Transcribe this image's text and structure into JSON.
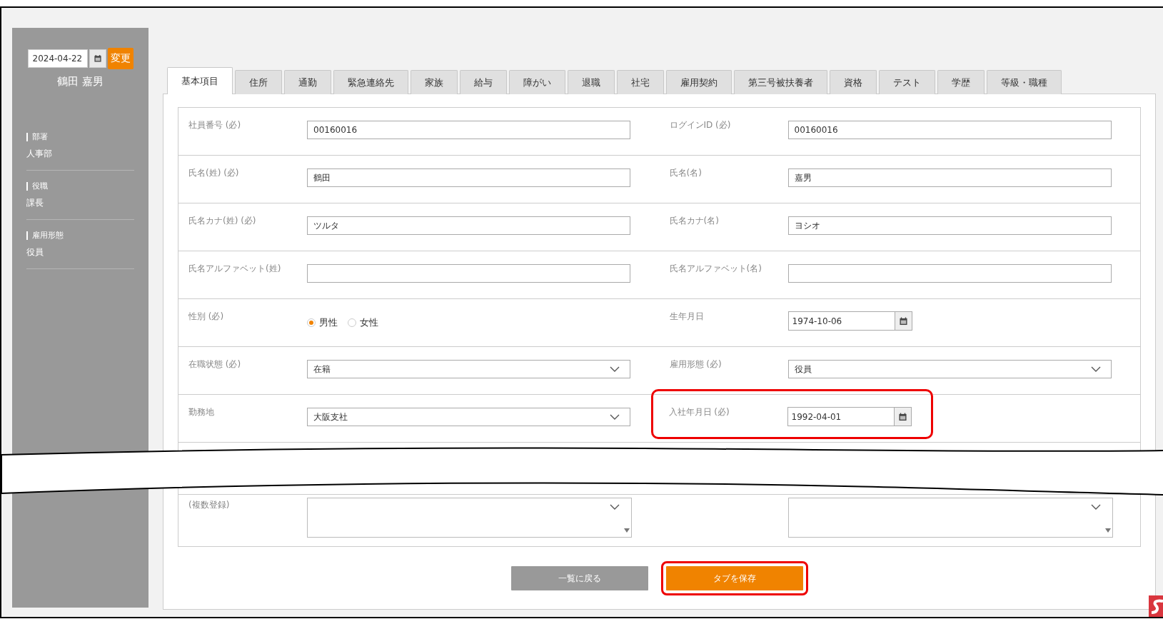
{
  "sidebar": {
    "date": "2024-04-22",
    "change_button": "変更",
    "employee_name": "鶴田 嘉男",
    "info": [
      {
        "label": "部署",
        "value": "人事部"
      },
      {
        "label": "役職",
        "value": "課長"
      },
      {
        "label": "雇用形態",
        "value": "役員"
      }
    ]
  },
  "tabs": [
    {
      "label": "基本項目",
      "selected": true
    },
    {
      "label": "住所",
      "selected": false
    },
    {
      "label": "通勤",
      "selected": false
    },
    {
      "label": "緊急連絡先",
      "selected": false
    },
    {
      "label": "家族",
      "selected": false
    },
    {
      "label": "給与",
      "selected": false
    },
    {
      "label": "障がい",
      "selected": false
    },
    {
      "label": "退職",
      "selected": false
    },
    {
      "label": "社宅",
      "selected": false
    },
    {
      "label": "雇用契約",
      "selected": false
    },
    {
      "label": "第三号被扶養者",
      "selected": false
    },
    {
      "label": "資格",
      "selected": false
    },
    {
      "label": "テスト",
      "selected": false
    },
    {
      "label": "学歴",
      "selected": false
    },
    {
      "label": "等級・職種",
      "selected": false
    }
  ],
  "form_rows": [
    [
      {
        "kind": "text",
        "label": "社員番号 (必)",
        "value": "00160016",
        "highlighted": false
      },
      {
        "kind": "text",
        "label": "ログインID (必)",
        "value": "00160016",
        "highlighted": false
      }
    ],
    [
      {
        "kind": "text",
        "label": "氏名(姓) (必)",
        "value": "鶴田",
        "highlighted": false
      },
      {
        "kind": "text",
        "label": "氏名(名)",
        "value": "嘉男",
        "highlighted": false
      }
    ],
    [
      {
        "kind": "text",
        "label": "氏名カナ(姓) (必)",
        "value": "ツルタ",
        "highlighted": false
      },
      {
        "kind": "text",
        "label": "氏名カナ(名)",
        "value": "ヨシオ",
        "highlighted": false
      }
    ],
    [
      {
        "kind": "text",
        "label": "氏名アルファベット(姓)",
        "highlighted": false
      },
      {
        "kind": "text",
        "label": "氏名アルファベット(名)",
        "highlighted": false
      }
    ],
    [
      {
        "kind": "radio",
        "label": "性別 (必)",
        "options": [
          {
            "label": "男性",
            "selected": true
          },
          {
            "label": "女性",
            "selected": false
          }
        ],
        "highlighted": false
      },
      {
        "kind": "date",
        "label": "生年月日",
        "value": "1974-10-06",
        "highlighted": false
      }
    ],
    [
      {
        "kind": "select",
        "label": "在職状態 (必)",
        "value": "在籍",
        "highlighted": false
      },
      {
        "kind": "select",
        "label": "雇用形態 (必)",
        "value": "役員",
        "highlighted": false
      }
    ],
    [
      {
        "kind": "select",
        "label": "勤務地",
        "value": "大阪支社",
        "highlighted": false
      },
      {
        "kind": "date",
        "label": "入社年月日 (必)",
        "value": "1992-04-01",
        "highlighted": true
      }
    ]
  ],
  "multi_row": [
    {
      "kind": "multiselect",
      "label": "(複数登録)"
    },
    {
      "kind": "multiselect"
    }
  ],
  "buttons": [
    {
      "kind": "back",
      "label": "一覧に戻る",
      "highlighted": false
    },
    {
      "kind": "save",
      "label": "タブを保存",
      "highlighted": true
    }
  ]
}
